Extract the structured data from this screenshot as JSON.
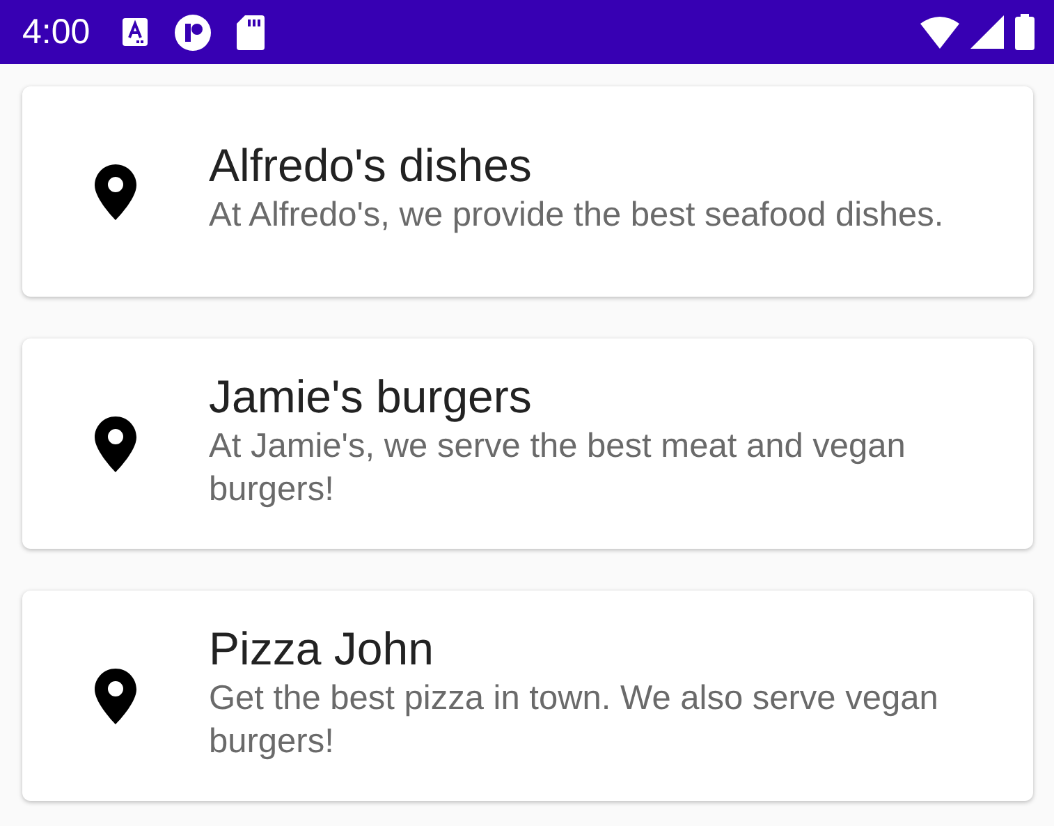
{
  "status_bar": {
    "time": "4:00"
  },
  "restaurants": [
    {
      "name": "Alfredo's dishes",
      "description": "At Alfredo's, we provide the best seafood dishes."
    },
    {
      "name": "Jamie's burgers",
      "description": "At Jamie's, we serve the best meat and vegan burgers!"
    },
    {
      "name": "Pizza John",
      "description": "Get the best pizza in town. We also serve vegan burgers!"
    }
  ]
}
